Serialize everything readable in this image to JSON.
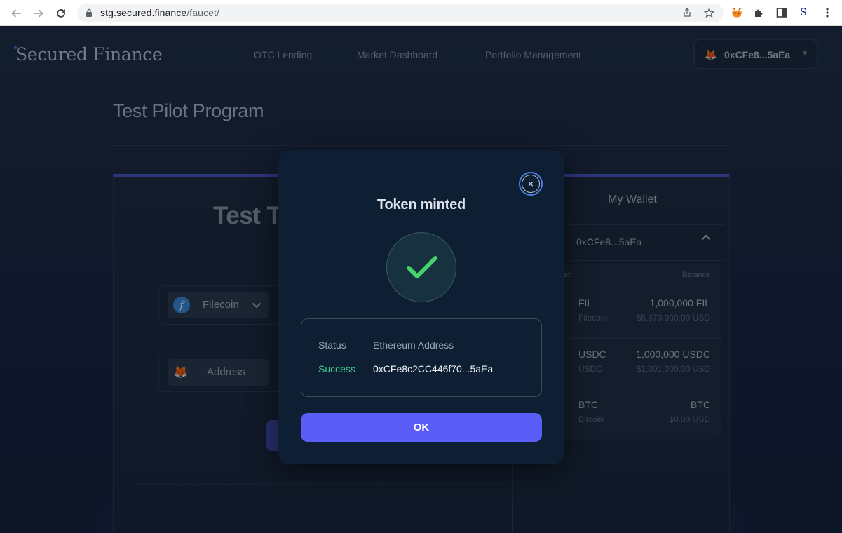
{
  "browser": {
    "url_host": "stg.secured.finance",
    "url_path": "/faucet/"
  },
  "header": {
    "logo": "Secured Finance",
    "nav": [
      "OTC Lending",
      "Market Dashboard",
      "Portfolio Management"
    ],
    "wallet_address": "0xCFe8...5aEa"
  },
  "page": {
    "title": "Test Pilot Program",
    "faucet_title": "Test To",
    "token_select": "Filecoin",
    "address_label": "Address"
  },
  "wallet": {
    "tab": "My Wallet",
    "address": "0xCFe8...5aEa",
    "col_asset": "et",
    "col_balance": "Balance",
    "rows": [
      {
        "symbol": "FIL",
        "name": "Filecoin",
        "balance": "1,000,000 FIL",
        "usd": "$5,670,000.00 USD"
      },
      {
        "symbol": "USDC",
        "name": "USDC",
        "balance": "1,000,000 USDC",
        "usd": "$1,001,000.00 USD"
      },
      {
        "symbol": "BTC",
        "name": "Bitcoin",
        "balance": "BTC",
        "usd": "$0.00 USD"
      }
    ]
  },
  "modal": {
    "title": "Token minted",
    "close_glyph": "×",
    "status_label": "Status",
    "address_label": "Ethereum Address",
    "status_value": "Success",
    "address_value": "0xCFe8c2CC446f70...5aEa",
    "ok_label": "OK",
    "success_color": "#3ecf8e",
    "check_color": "#46d36b"
  },
  "icons": {
    "back": "back-arrow-icon",
    "forward": "forward-arrow-icon",
    "reload": "reload-icon",
    "lock": "lock-icon",
    "share": "share-icon",
    "star": "bookmark-star-icon",
    "metamask": "metamask-fox-icon",
    "extensions": "puzzle-icon",
    "sidebar": "side-panel-icon",
    "menu": "kebab-menu-icon"
  },
  "colors": {
    "accent": "#5b5ef6",
    "modal_bg": "#0f1f33",
    "page_bg": "#16233a"
  }
}
